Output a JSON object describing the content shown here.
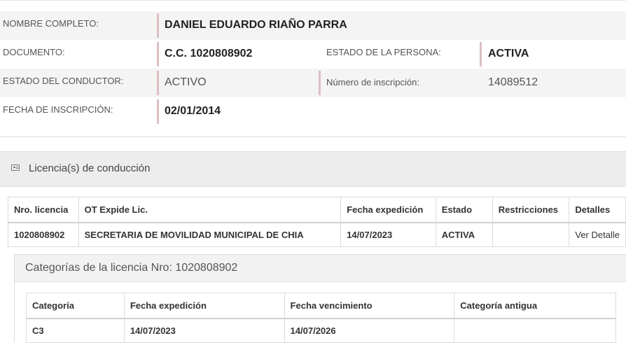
{
  "person": {
    "nombre_label": "NOMBRE COMPLETO:",
    "nombre_value": "DANIEL EDUARDO RIAÑO PARRA",
    "documento_label": "DOCUMENTO:",
    "documento_value": "C.C. 1020808902",
    "estado_persona_label": "ESTADO DE LA PERSONA:",
    "estado_persona_value": "ACTIVA",
    "estado_conductor_label": "ESTADO DEL CONDUCTOR:",
    "estado_conductor_value": "ACTIVO",
    "numero_inscripcion_label": "Número de inscripción:",
    "numero_inscripcion_value": "14089512",
    "fecha_inscripcion_label": "FECHA DE INSCRIPCIÓN:",
    "fecha_inscripcion_value": "02/01/2014"
  },
  "licencias": {
    "section_title": "Licencia(s) de conducción",
    "icon": "id-card-icon",
    "headers": [
      "Nro. licencia",
      "OT Expide Lic.",
      "Fecha expedición",
      "Estado",
      "Restricciones",
      "Detalles"
    ],
    "rows": [
      {
        "nro": "1020808902",
        "ot": "SECRETARIA DE MOVILIDAD MUNICIPAL DE CHIA",
        "fecha": "14/07/2023",
        "estado": "ACTIVA",
        "restricciones": "",
        "detalles": "Ver Detalle"
      }
    ]
  },
  "categorias": {
    "title": "Categorías de la licencia Nro: 1020808902",
    "headers": [
      "Categoría",
      "Fecha expedición",
      "Fecha vencimiento",
      "Categoría antigua"
    ],
    "rows": [
      {
        "categoria": "C3",
        "expedicion": "14/07/2023",
        "vencimiento": "14/07/2026",
        "antigua": ""
      }
    ]
  }
}
